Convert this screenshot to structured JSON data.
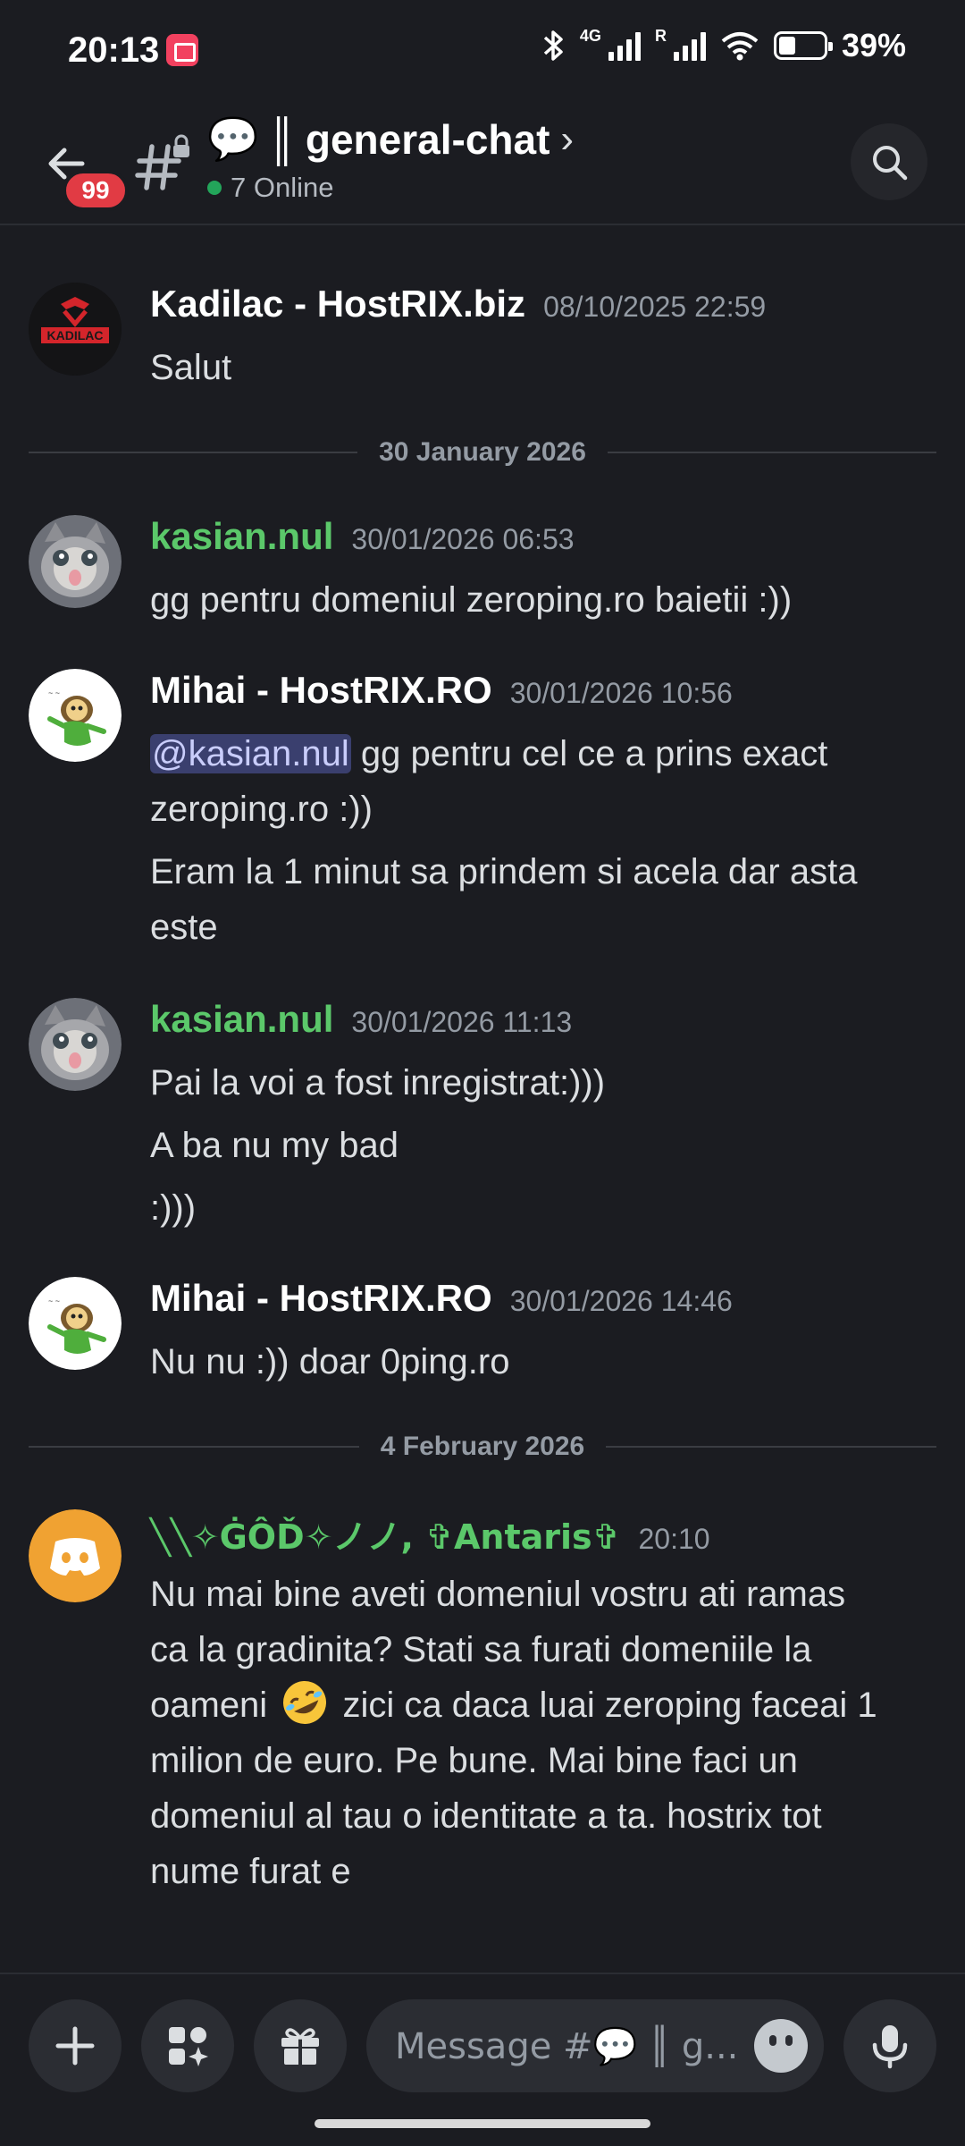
{
  "status_bar": {
    "time": "20:13",
    "network_label": "4G",
    "roaming_label": "R",
    "battery": "39%"
  },
  "header": {
    "unread_badge": "99",
    "channel_emoji": "💬",
    "channel_separator": "║",
    "channel_name": "general-chat",
    "online_count": "7 Online"
  },
  "messages": [
    {
      "author": "Kadilac - HostRIX.biz",
      "timestamp": "08/10/2025 22:59",
      "lines": [
        "Salut"
      ],
      "avatar_text": "KADILAC"
    },
    {
      "divider": "30 January 2026"
    },
    {
      "author": "kasian.nul",
      "timestamp": "30/01/2026 06:53",
      "lines": [
        "gg pentru domeniul zeroping.ro baietii :))"
      ]
    },
    {
      "author": "Mihai - HostRIX.RO",
      "timestamp": "30/01/2026 10:56",
      "mention": "@kasian.nul",
      "lines": [
        " gg pentru cel ce a prins exact",
        "zeroping.ro :))",
        "Eram la 1 minut sa prindem si acela dar asta",
        "este"
      ]
    },
    {
      "author": "kasian.nul",
      "timestamp": "30/01/2026 11:13",
      "lines": [
        "Pai la voi a fost inregistrat:)))",
        "A ba nu my bad",
        ":)))"
      ]
    },
    {
      "author": "Mihai - HostRIX.RO",
      "timestamp": "30/01/2026 14:46",
      "lines": [
        "Nu nu :)) doar 0ping.ro"
      ]
    },
    {
      "divider": "4 February 2026"
    },
    {
      "author": "╲╲✧ĠÔĎ✧ノノ, ✞Antaris✞",
      "timestamp": "20:10",
      "lines": [
        "Nu mai bine aveti domeniul vostru ati ramas",
        "ca la gradinita? Stati sa furati domeniile la",
        "oameni",
        " zici ca daca luai zeroping faceai 1",
        "milion de euro. Pe bune. Mai bine faci un",
        "domeniul al tau o identitate a ta. hostrix tot",
        "nume furat e"
      ]
    }
  ],
  "composer": {
    "placeholder": "Message #💬 ║ g..."
  },
  "icons": {
    "back": "arrow-left-icon",
    "channel": "hashtag-lock-icon",
    "search": "search-icon",
    "add": "plus-icon",
    "apps": "apps-icon",
    "gift": "gift-icon",
    "emoji": "emoji-icon",
    "mic": "microphone-icon",
    "laugh_emoji": "rolling-on-floor-laughing-emoji"
  },
  "colors": {
    "background": "#1b1c21",
    "green_username": "#5bc86a",
    "badge_red": "#e13b44",
    "mention_bg": "#3a3f6e",
    "online_green": "#23a55a"
  }
}
